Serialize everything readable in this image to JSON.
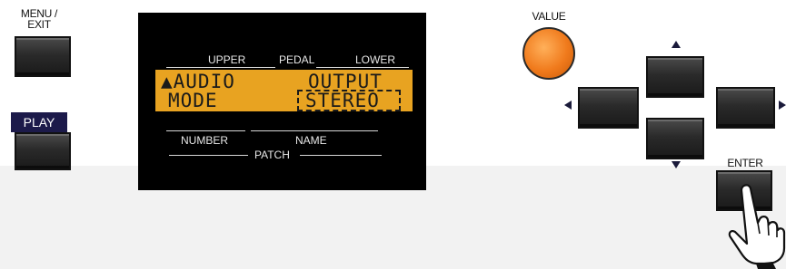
{
  "panel": {
    "menu_exit_label": "MENU /\nEXIT",
    "play_label": "PLAY",
    "value_label": "VALUE",
    "enter_label": "ENTER"
  },
  "display": {
    "top_labels": {
      "upper": "UPPER",
      "pedal": "PEDAL",
      "lower": "LOWER"
    },
    "bottom_labels": {
      "number": "NUMBER",
      "name": "NAME",
      "patch": "PATCH"
    },
    "lcd": {
      "line1_left": "▲AUDIO",
      "line1_right": "OUTPUT",
      "line2_left": "MODE",
      "line2_value": "STEREO"
    }
  },
  "colors": {
    "lcd_background": "#e8a321",
    "knob": "#f07a1c",
    "play_label_bg": "#1c1a4a",
    "button": "#2a2a2a"
  },
  "icons": {
    "up": "arrow-up-icon",
    "down": "arrow-down-icon",
    "left": "arrow-left-icon",
    "right": "arrow-right-icon",
    "hand": "pointing-hand-icon"
  }
}
